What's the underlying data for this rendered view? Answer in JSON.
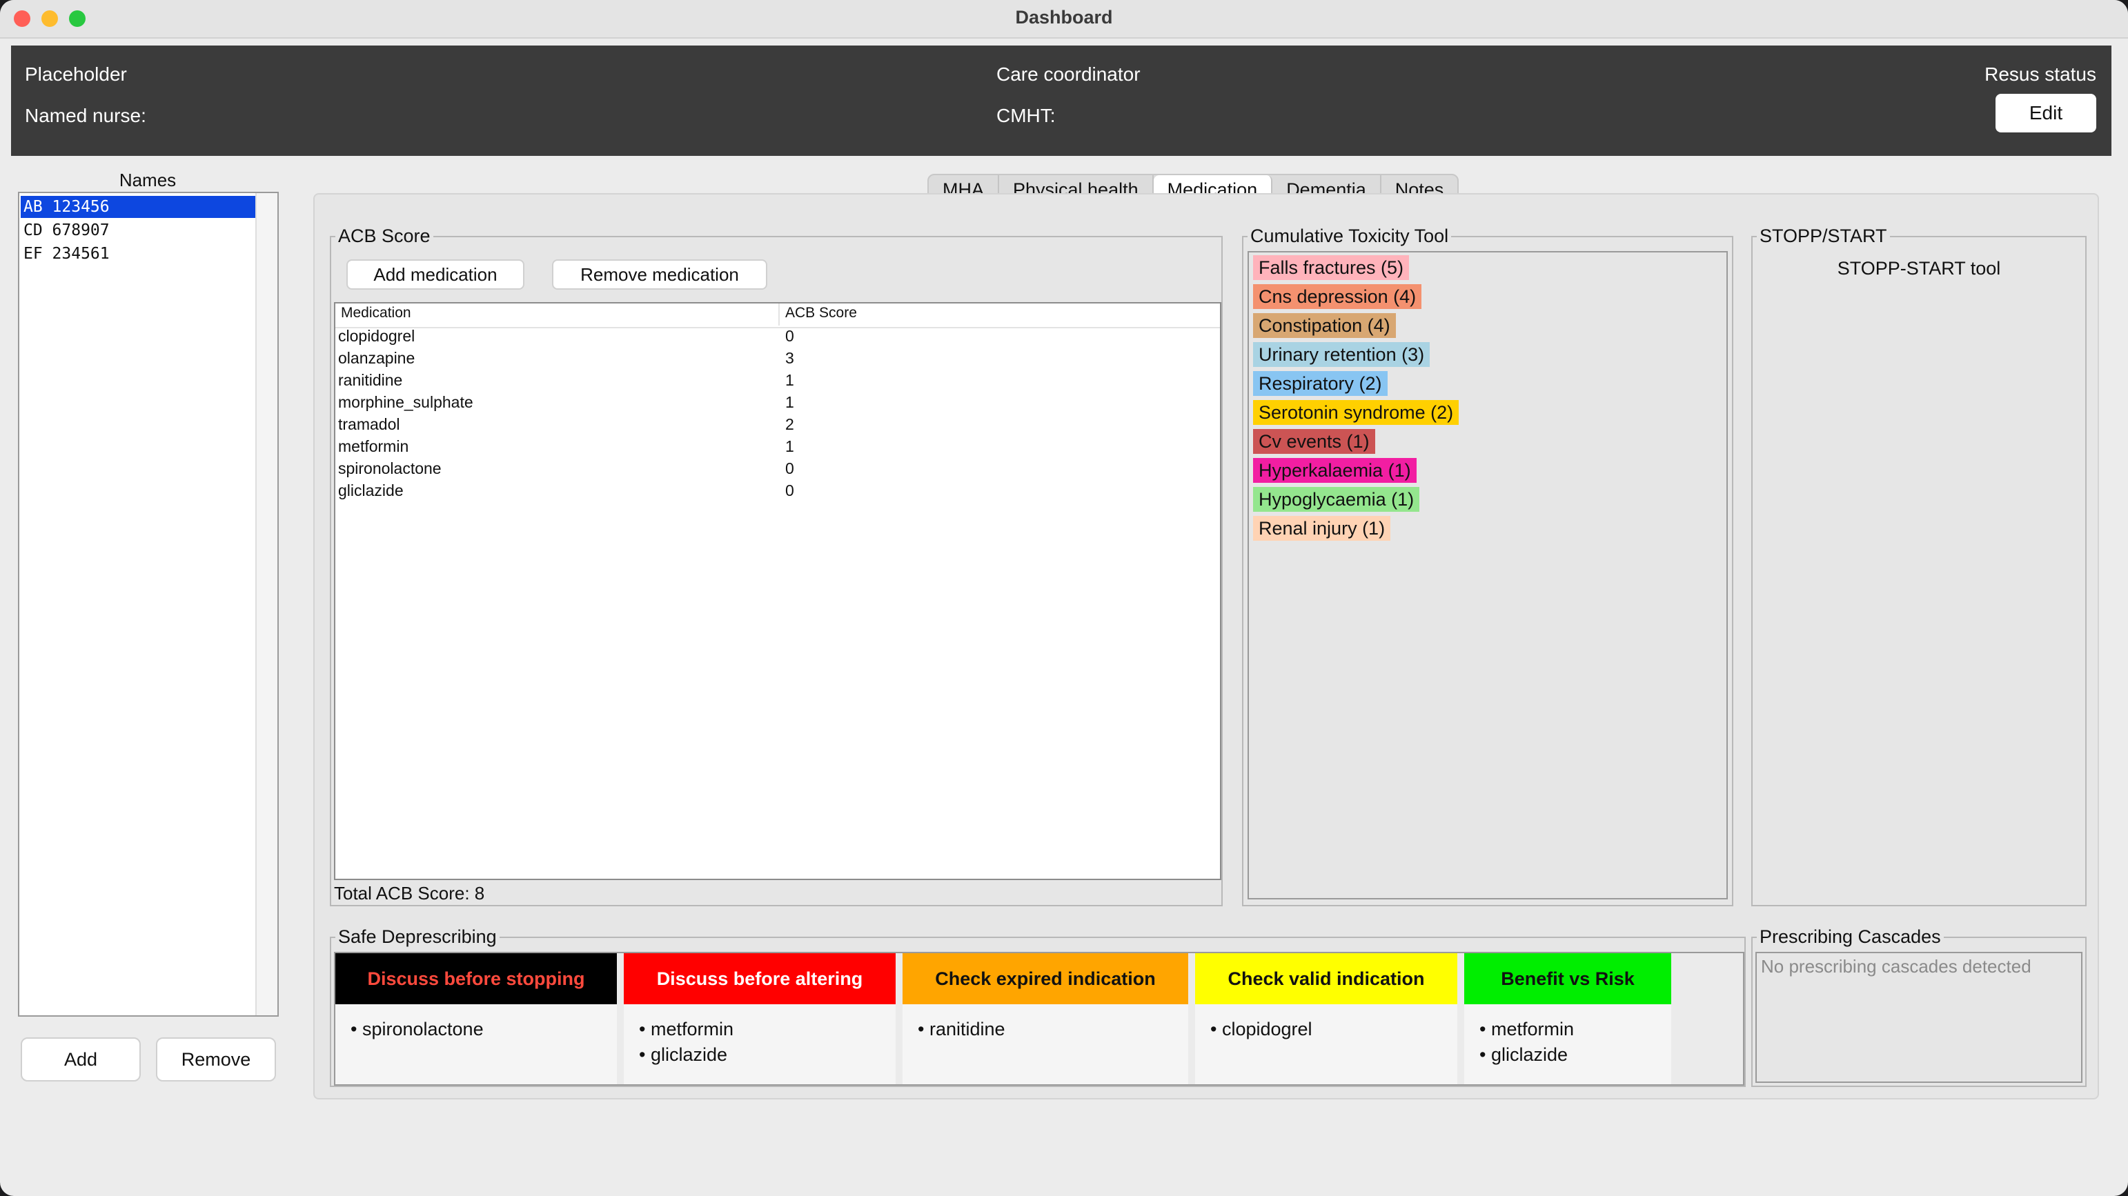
{
  "window": {
    "title": "Dashboard"
  },
  "header": {
    "name": "Placeholder",
    "named_nurse_label": "Named nurse:",
    "care_coordinator_label": "Care coordinator",
    "cmht_label": "CMHT:",
    "resus_status_label": "Resus status",
    "edit_label": "Edit"
  },
  "names_panel": {
    "label": "Names",
    "items": [
      "AB 123456",
      "CD 678907",
      "EF 234561"
    ],
    "selected": "AB 123456",
    "add_label": "Add",
    "remove_label": "Remove"
  },
  "tabs": [
    {
      "label": "MHA",
      "active": false
    },
    {
      "label": "Physical health",
      "active": false
    },
    {
      "label": "Medication",
      "active": true
    },
    {
      "label": "Dementia",
      "active": false
    },
    {
      "label": "Notes",
      "active": false
    }
  ],
  "acb": {
    "title": "ACB Score",
    "add_label": "Add medication",
    "remove_label": "Remove medication",
    "columns": [
      "Medication",
      "ACB Score"
    ],
    "rows": [
      [
        "clopidogrel",
        "0"
      ],
      [
        "olanzapine",
        "3"
      ],
      [
        "ranitidine",
        "1"
      ],
      [
        "morphine_sulphate",
        "1"
      ],
      [
        "tramadol",
        "2"
      ],
      [
        "metformin",
        "1"
      ],
      [
        "spironolactone",
        "0"
      ],
      [
        "gliclazide",
        "0"
      ]
    ],
    "total": "Total ACB Score: 8"
  },
  "toxicity": {
    "title": "Cumulative Toxicity Tool",
    "items": [
      {
        "label": "Falls fractures (5)",
        "color": "#ffb3bb",
        "text_color": "#111111"
      },
      {
        "label": "Cns depression (4)",
        "color": "#f4916f",
        "text_color": "#111111"
      },
      {
        "label": "Constipation (4)",
        "color": "#d8a772",
        "text_color": "#111111"
      },
      {
        "label": "Urinary retention (3)",
        "color": "#a9d3e3",
        "text_color": "#111111"
      },
      {
        "label": "Respiratory (2)",
        "color": "#88c5f2",
        "text_color": "#111111"
      },
      {
        "label": "Serotonin syndrome (2)",
        "color": "#ffd000",
        "text_color": "#111111"
      },
      {
        "label": "Cv events (1)",
        "color": "#cc5454",
        "text_color": "#111111"
      },
      {
        "label": "Hyperkalaemia (1)",
        "color": "#f21ea2",
        "text_color": "#111111"
      },
      {
        "label": "Hypoglycaemia (1)",
        "color": "#94e68e",
        "text_color": "#111111"
      },
      {
        "label": "Renal injury (1)",
        "color": "#ffd3b4",
        "text_color": "#111111"
      }
    ]
  },
  "stopp": {
    "title": "STOPP/START",
    "tool_label": "STOPP-START tool"
  },
  "safe_deprescribing": {
    "title": "Safe Deprescribing",
    "cards": [
      {
        "header": "Discuss before stopping",
        "bg": "#000000",
        "fg": "#ff4a3d",
        "items": [
          "spironolactone"
        ]
      },
      {
        "header": "Discuss before altering",
        "bg": "#ff0000",
        "fg": "#ffffff",
        "items": [
          "metformin",
          "gliclazide"
        ]
      },
      {
        "header": "Check expired indication",
        "bg": "#ffa500",
        "fg": "#111111",
        "items": [
          "ranitidine"
        ]
      },
      {
        "header": "Check valid indication",
        "bg": "#ffff00",
        "fg": "#111111",
        "items": [
          "clopidogrel"
        ]
      },
      {
        "header": "Benefit vs Risk",
        "bg": "#00ee00",
        "fg": "#111111",
        "items": [
          "metformin",
          "gliclazide"
        ]
      }
    ]
  },
  "cascades": {
    "title": "Prescribing Cascades",
    "text": "No prescribing cascades detected"
  }
}
